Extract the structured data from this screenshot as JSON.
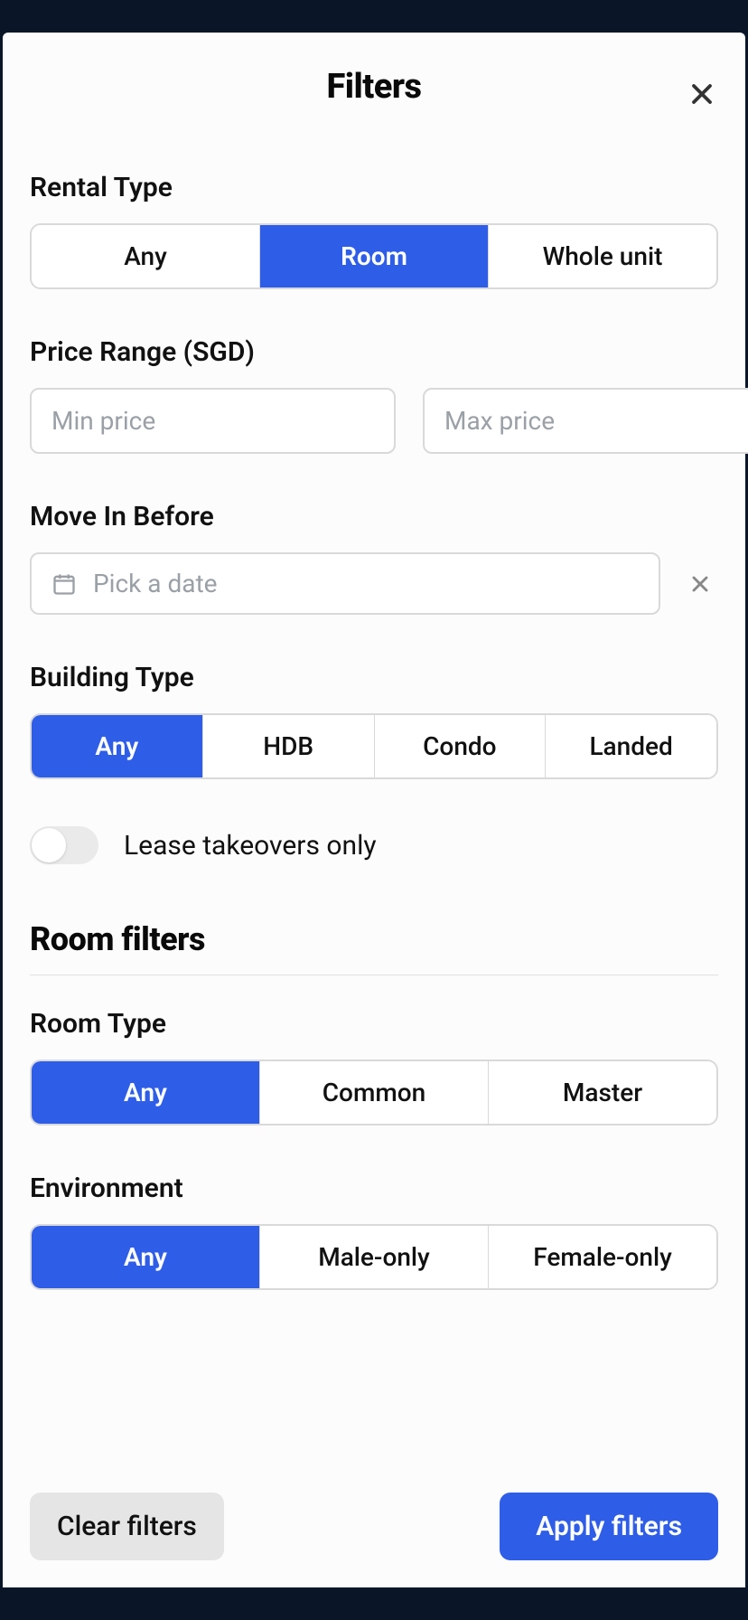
{
  "modal": {
    "title": "Filters"
  },
  "rental_type": {
    "label": "Rental Type",
    "options": {
      "any": "Any",
      "room": "Room",
      "whole": "Whole unit"
    },
    "selected": "room"
  },
  "price_range": {
    "label": "Price Range (SGD)",
    "min_placeholder": "Min price",
    "max_placeholder": "Max price",
    "min_value": "",
    "max_value": ""
  },
  "move_in": {
    "label": "Move In Before",
    "placeholder": "Pick a date",
    "value": ""
  },
  "building_type": {
    "label": "Building Type",
    "options": {
      "any": "Any",
      "hdb": "HDB",
      "condo": "Condo",
      "landed": "Landed"
    },
    "selected": "any"
  },
  "lease_takeover": {
    "label": "Lease takeovers only",
    "value": false
  },
  "room_filters_header": "Room filters",
  "room_type": {
    "label": "Room Type",
    "options": {
      "any": "Any",
      "common": "Common",
      "master": "Master"
    },
    "selected": "any"
  },
  "environment": {
    "label": "Environment",
    "options": {
      "any": "Any",
      "male": "Male-only",
      "female": "Female-only"
    },
    "selected": "any"
  },
  "footer": {
    "clear": "Clear filters",
    "apply": "Apply filters"
  }
}
